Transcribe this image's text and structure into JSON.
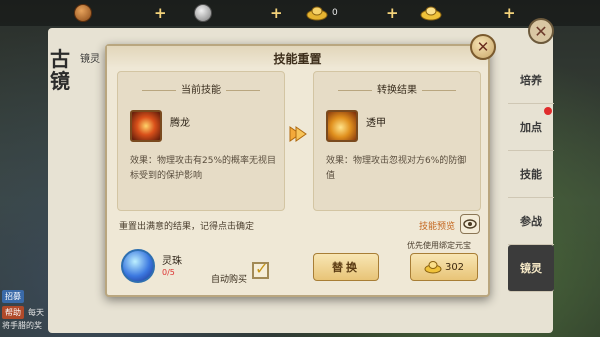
{
  "top_bar": {
    "resources": [
      {
        "icon": "copper-coin-icon",
        "value": "",
        "color": "#b06a2a"
      },
      {
        "icon": "silver-coin-icon",
        "value": "",
        "color": "#a8a8a8"
      },
      {
        "icon": "gold-ingot-icon",
        "value": "0",
        "color": "#e6b431"
      },
      {
        "icon": "gold-ingot-icon",
        "value": "",
        "color": "#f0c23a"
      }
    ],
    "plus_label": "+"
  },
  "background_panel": {
    "title": "古镜",
    "top_tab": "镜灵",
    "close_label": "✕",
    "side_tabs": [
      "培养",
      "加点",
      "技能",
      "参战",
      "镜灵"
    ],
    "active_side_tab": "镜灵",
    "chat": {
      "tag1": "招募",
      "tag2": "帮助",
      "line1": "每天",
      "line2": "将手腊的奖"
    }
  },
  "modal": {
    "title": "技能重置",
    "close_label": "✕",
    "current": {
      "header": "当前技能",
      "skill_name": "腾龙",
      "description": "效果：物理攻击有25%的概率无视目标受到的保护影响"
    },
    "result": {
      "header": "转换结果",
      "skill_name": "透甲",
      "description": "效果：物理攻击忽视对方6%的防御值"
    },
    "hint": "重置出满意的结果，记得点击确定",
    "preview_label": "技能预览",
    "item": {
      "name": "灵珠",
      "count": "0/5"
    },
    "auto_buy_label": "自动购买",
    "auto_buy_checked": true,
    "replace_button": "替换",
    "prefer_label": "优先使用绑定元宝",
    "cost_value": "302",
    "colors": {
      "accent": "#c4661e",
      "count_red": "#dd3333"
    }
  }
}
